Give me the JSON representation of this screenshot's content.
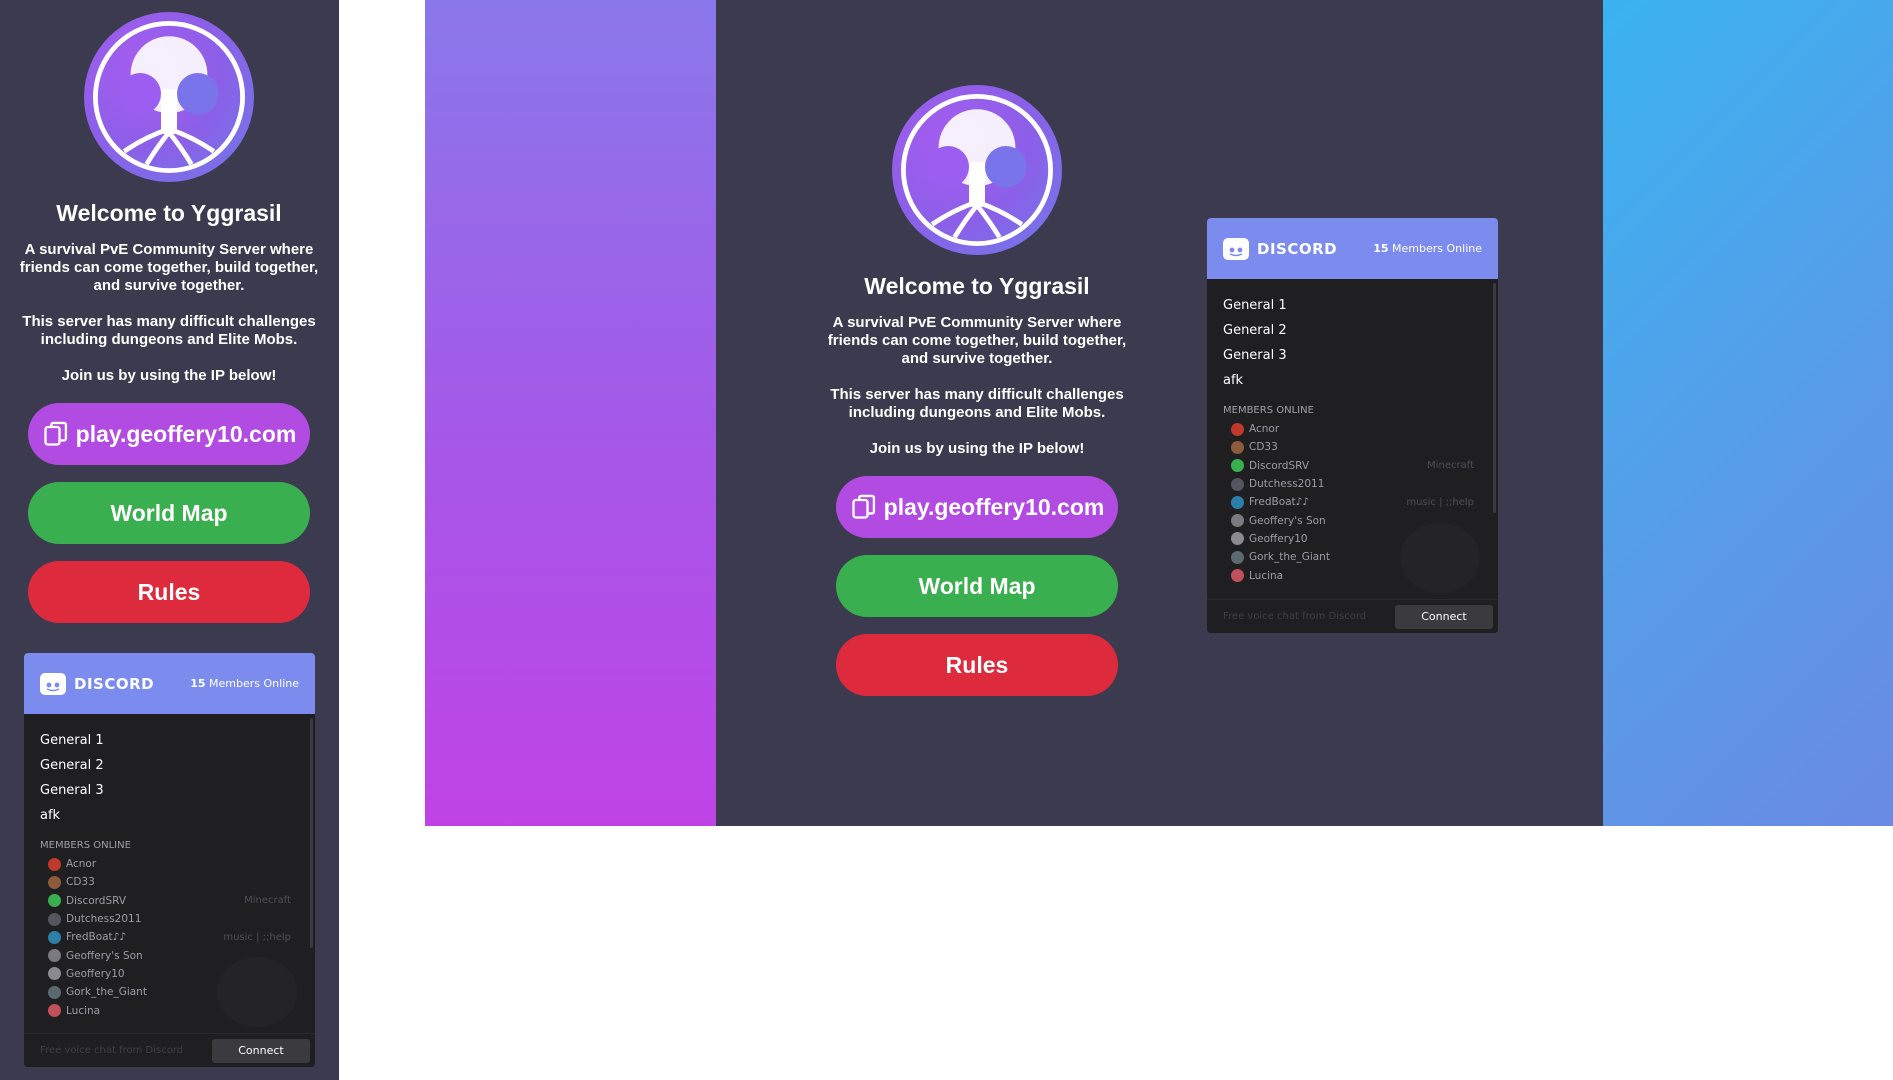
{
  "welcome": {
    "title": "Welcome to Yggrasil",
    "desc1": "A survival PvE Community Server where friends can come together, build together, and survive together.",
    "desc2": "This server has many difficult challenges including dungeons and Elite Mobs.",
    "desc3": "Join us by using the IP below!",
    "ip_button": "play.geoffery10.com",
    "map_button": "World Map",
    "rules_button": "Rules"
  },
  "discord": {
    "brand": "DISCORD",
    "online_count": "15",
    "online_label": "Members Online",
    "channels": [
      "General 1",
      "General 2",
      "General 3",
      "afk"
    ],
    "members_header": "MEMBERS ONLINE",
    "members": [
      {
        "name": "Acnor",
        "game": "",
        "color": "#c0392b"
      },
      {
        "name": "CD33",
        "game": "",
        "color": "#8e5a3c"
      },
      {
        "name": "DiscordSRV",
        "game": "Minecraft",
        "color": "#3aaf50"
      },
      {
        "name": "Dutchess2011",
        "game": "",
        "color": "#555560"
      },
      {
        "name": "FredBoat♪♪",
        "game": "music | ;;help",
        "color": "#2c7fa8"
      },
      {
        "name": "Geoffery's Son",
        "game": "",
        "color": "#7a7a80"
      },
      {
        "name": "Geoffery10",
        "game": "",
        "color": "#8a8a90"
      },
      {
        "name": "Gork_the_Giant",
        "game": "",
        "color": "#5a6a70"
      },
      {
        "name": "Lucina",
        "game": "",
        "color": "#c0505a"
      }
    ],
    "footer_text": "Free voice chat from Discord",
    "connect_label": "Connect"
  },
  "colors": {
    "panel": "#3b3a4e",
    "ip_button": "#b14be1",
    "map_button": "#3aaf50",
    "rules_button": "#dd2b3d",
    "discord_header": "#7b8cee"
  }
}
